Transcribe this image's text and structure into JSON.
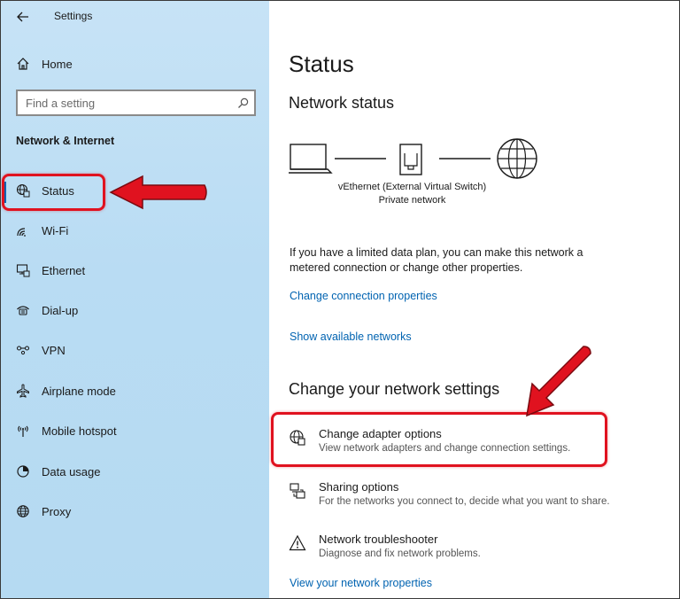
{
  "window": {
    "title": "Settings"
  },
  "sidebar": {
    "home_label": "Home",
    "search_placeholder": "Find a setting",
    "section_heading": "Network & Internet",
    "items": [
      {
        "label": "Status",
        "icon": "globe-ethernet-icon",
        "selected": true
      },
      {
        "label": "Wi-Fi",
        "icon": "wifi-icon"
      },
      {
        "label": "Ethernet",
        "icon": "ethernet-icon"
      },
      {
        "label": "Dial-up",
        "icon": "dialup-icon"
      },
      {
        "label": "VPN",
        "icon": "vpn-icon"
      },
      {
        "label": "Airplane mode",
        "icon": "airplane-icon"
      },
      {
        "label": "Mobile hotspot",
        "icon": "hotspot-icon"
      },
      {
        "label": "Data usage",
        "icon": "data-usage-icon"
      },
      {
        "label": "Proxy",
        "icon": "globe-icon"
      }
    ]
  },
  "main": {
    "page_title": "Status",
    "network_status_heading": "Network status",
    "adapter_name": "vEthernet (External Virtual Switch)",
    "network_type": "Private network",
    "info_text": "If you have a limited data plan, you can make this network a metered connection or change other properties.",
    "links": {
      "change_connection": "Change connection properties",
      "show_networks": "Show available networks",
      "view_properties": "View your network properties"
    },
    "change_settings_heading": "Change your network settings",
    "options": [
      {
        "title": "Change adapter options",
        "desc": "View network adapters and change connection settings.",
        "icon": "adapter-icon"
      },
      {
        "title": "Sharing options",
        "desc": "For the networks you connect to, decide what you want to share.",
        "icon": "sharing-icon"
      },
      {
        "title": "Network troubleshooter",
        "desc": "Diagnose and fix network problems.",
        "icon": "warning-icon"
      }
    ]
  },
  "colors": {
    "accent": "#0063b1",
    "highlight": "#e0121f",
    "sidebar_bg": "#bfe0f5"
  }
}
